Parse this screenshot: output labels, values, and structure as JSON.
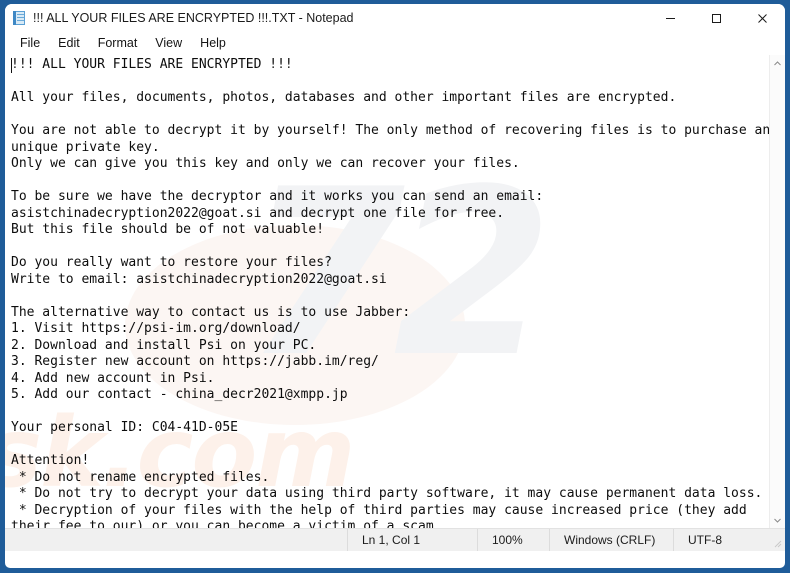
{
  "window": {
    "title": "!!! ALL YOUR FILES ARE ENCRYPTED !!!.TXT - Notepad",
    "app_icon": "notepad-icon",
    "frame_color": "#1f5c99",
    "caption": {
      "minimize": "minimize-icon",
      "maximize": "maximize-icon",
      "close": "close-icon"
    }
  },
  "menubar": {
    "items": [
      {
        "label": "File"
      },
      {
        "label": "Edit"
      },
      {
        "label": "Format"
      },
      {
        "label": "View"
      },
      {
        "label": "Help"
      }
    ]
  },
  "editor": {
    "lines": [
      "!!! ALL YOUR FILES ARE ENCRYPTED !!!",
      "",
      "All your files, documents, photos, databases and other important files are encrypted.",
      "",
      "You are not able to decrypt it by yourself! The only method of recovering files is to purchase an",
      "unique private key.",
      "Only we can give you this key and only we can recover your files.",
      "",
      "To be sure we have the decryptor and it works you can send an email:",
      "asistchinadecryption2022@goat.si and decrypt one file for free.",
      "But this file should be of not valuable!",
      "",
      "Do you really want to restore your files?",
      "Write to email: asistchinadecryption2022@goat.si",
      "",
      "The alternative way to contact us is to use Jabber:",
      "1. Visit https://psi-im.org/download/",
      "2. Download and install Psi on your PC.",
      "3. Register new account on https://jabb.im/reg/",
      "4. Add new account in Psi.",
      "5. Add our contact - china_decr2021@xmpp.jp",
      "",
      "Your personal ID: C04-41D-05E",
      "",
      "Attention!",
      " * Do not rename encrypted files.",
      " * Do not try to decrypt your data using third party software, it may cause permanent data loss.",
      " * Decryption of your files with the help of third parties may cause increased price (they add",
      "their fee to our) or you can become a victim of a scam."
    ],
    "contact_email": "asistchinadecryption2022@goat.si",
    "jabber_contact": "china_decr2021@xmpp.jp",
    "personal_id": "C04-41D-05E",
    "psi_url": "https://psi-im.org/download/",
    "jabber_register_url": "https://jabb.im/reg/",
    "text_color": "#0d0d0d",
    "background": "#ffffff"
  },
  "watermark": {
    "mark": "72",
    "word": "sk.com",
    "mark_color": "#f2f3f5",
    "word_color": "#fdf1ea"
  },
  "scrollbar": {
    "up_arrow": "chevron-up-icon",
    "down_arrow": "chevron-down-icon"
  },
  "statusbar": {
    "position": "Ln 1, Col 1",
    "zoom": "100%",
    "line_ending": "Windows (CRLF)",
    "encoding": "UTF-8",
    "background": "#f0f0f0"
  }
}
